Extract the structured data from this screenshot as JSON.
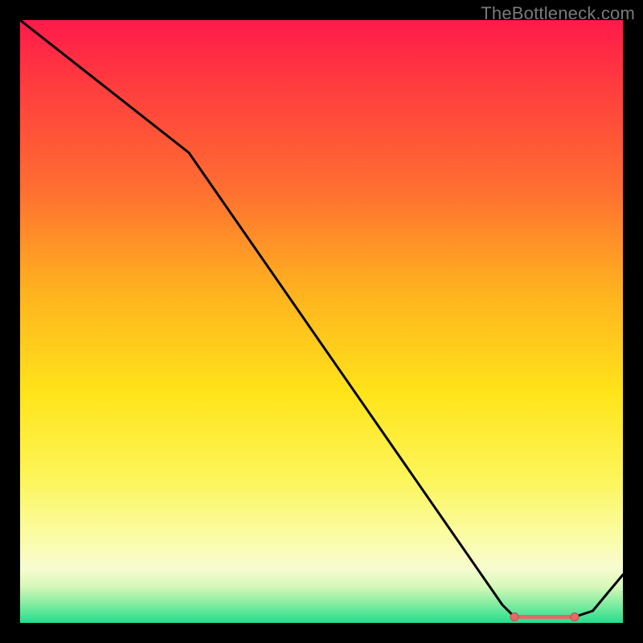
{
  "watermark": "TheBottleneck.com",
  "chart_data": {
    "type": "line",
    "title": "",
    "xlabel": "",
    "ylabel": "",
    "xlim": [
      0,
      100
    ],
    "ylim": [
      0,
      100
    ],
    "x": [
      0,
      28,
      80,
      82,
      85,
      88,
      90,
      92,
      95,
      100
    ],
    "values": [
      100,
      78,
      3,
      1,
      1,
      1,
      1,
      1,
      2,
      8
    ],
    "marker_range_x": [
      82,
      92
    ],
    "background_gradient": {
      "stops": [
        {
          "pos": 0.0,
          "color": "#ff1a4b"
        },
        {
          "pos": 0.45,
          "color": "#ffb21f"
        },
        {
          "pos": 0.76,
          "color": "#fdf559"
        },
        {
          "pos": 0.94,
          "color": "#d6f8b8"
        },
        {
          "pos": 1.0,
          "color": "#22df8e"
        }
      ]
    }
  }
}
